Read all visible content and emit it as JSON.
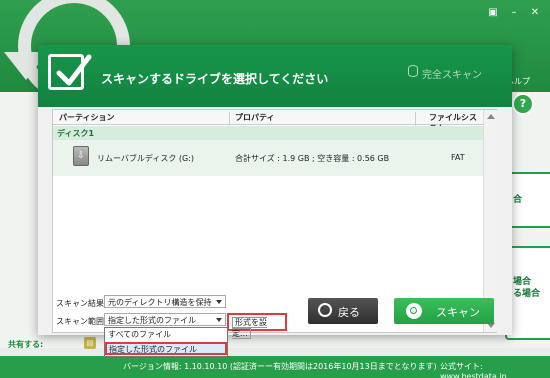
{
  "background": {
    "help_label": "ヘルプ",
    "help_icon": "?",
    "card1_text": "合",
    "card2_text": "場合\nる場合",
    "share_label": "共有する:",
    "share_icon": "share-icon"
  },
  "dialog": {
    "title": "スキャンするドライブを選択してください",
    "full_scan_label": "完全スキャン",
    "table": {
      "headers": [
        "パーティション",
        "プロパティ",
        "ファイルシステム"
      ],
      "disk_label": "ディスク1",
      "drives": [
        {
          "name": "リムーバブルディスク (G:)",
          "properties": "合計サイズ : 1.9 GB ; 空き容量 : 0.56 GB",
          "fs": "FAT",
          "icon": "usb-drive-icon"
        }
      ]
    },
    "scan_result_label": "スキャン結果:",
    "scan_result_value": "元のディレクトリ構造を保持",
    "scan_scope_label": "スキャン範囲:",
    "scan_scope_value": "指定した形式のファイル",
    "format_button": "形式を設定...",
    "back_button": "戻る",
    "scan_button": "スキャン",
    "dropdown_options": [
      "すべてのファイル",
      "指定した形式のファイル"
    ]
  },
  "footer": {
    "version": "バージョン情報: 1.10.10.10 (認証済ーー有効期間は2016年10月13日までとなります)",
    "site": "公式サイト: www.bestdata.jp"
  },
  "colors": {
    "brand_green": "#1f8a3f",
    "highlight_red": "#e23a3a"
  }
}
